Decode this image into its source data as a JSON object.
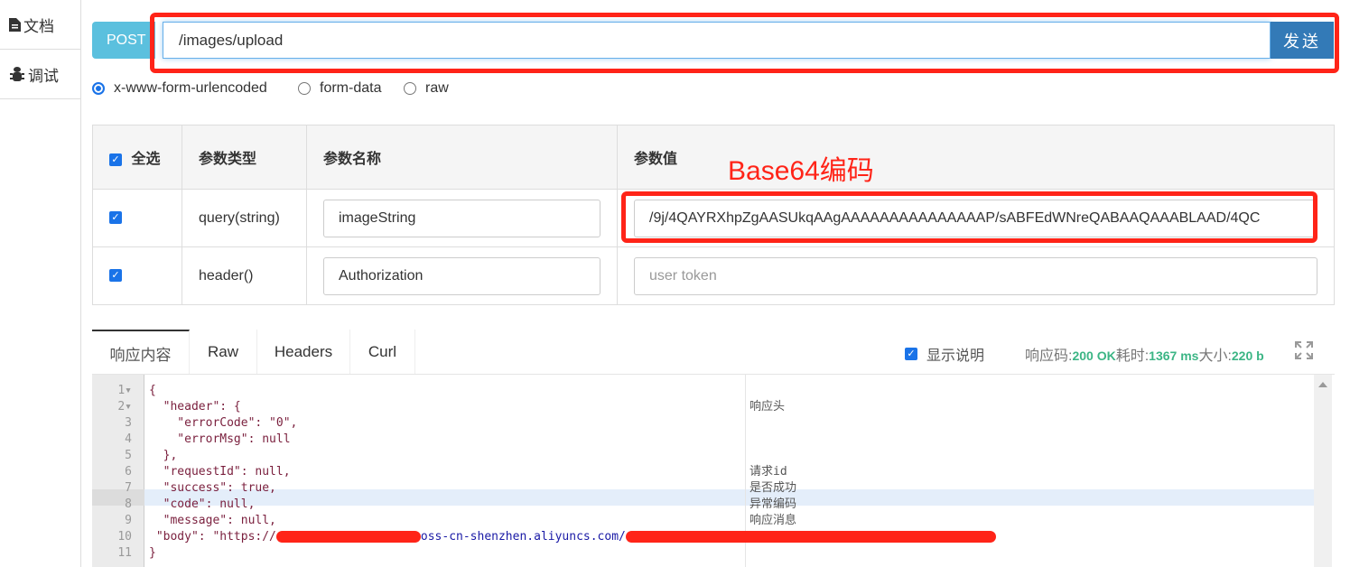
{
  "sidebar": {
    "items": [
      {
        "label": "文档",
        "icon": "file-icon"
      },
      {
        "label": "调试",
        "icon": "bug-icon"
      }
    ]
  },
  "request": {
    "method": "POST",
    "url": "/images/upload",
    "send_label": "发送"
  },
  "body_types": [
    {
      "label": "x-www-form-urlencoded",
      "selected": true
    },
    {
      "label": "form-data",
      "selected": false
    },
    {
      "label": "raw",
      "selected": false
    }
  ],
  "params": {
    "headers": {
      "select_all": "全选",
      "type": "参数类型",
      "name": "参数名称",
      "value": "参数值"
    },
    "rows": [
      {
        "checked": true,
        "type": "query(string)",
        "name": "imageString",
        "value": "/9j/4QAYRXhpZgAASUkqAAgAAAAAAAAAAAAAAAP/sABFEdWNreQABAAQAAABLAAD/4QC",
        "placeholder": ""
      },
      {
        "checked": true,
        "type": "header()",
        "name": "Authorization",
        "value": "",
        "placeholder": "user token"
      }
    ]
  },
  "annotation": {
    "text": "Base64编码",
    "color": "#ff2418"
  },
  "response": {
    "tabs": [
      "响应内容",
      "Raw",
      "Headers",
      "Curl"
    ],
    "active_tab": "响应内容",
    "show_desc_label": "显示说明",
    "show_desc_checked": true,
    "status_label": "响应码:",
    "status_value": "200 OK",
    "time_label": "耗时:",
    "time_value": "1367 ms",
    "size_label": "大小:",
    "size_value": "220 b",
    "code_lines": [
      "{",
      "  \"header\": {",
      "    \"errorCode\": \"0\",",
      "    \"errorMsg\": null",
      "  },",
      "  \"requestId\": null,",
      "  \"success\": true,",
      "  \"code\": null,",
      "  \"message\": null,",
      " \"body\": \"https://",
      "}"
    ],
    "body_url_visible": "oss-cn-shenzhen.aliyuncs.com/",
    "notes": {
      "2": "响应头",
      "6": "请求id",
      "7": "是否成功",
      "8": "异常编码",
      "9": "响应消息"
    }
  }
}
